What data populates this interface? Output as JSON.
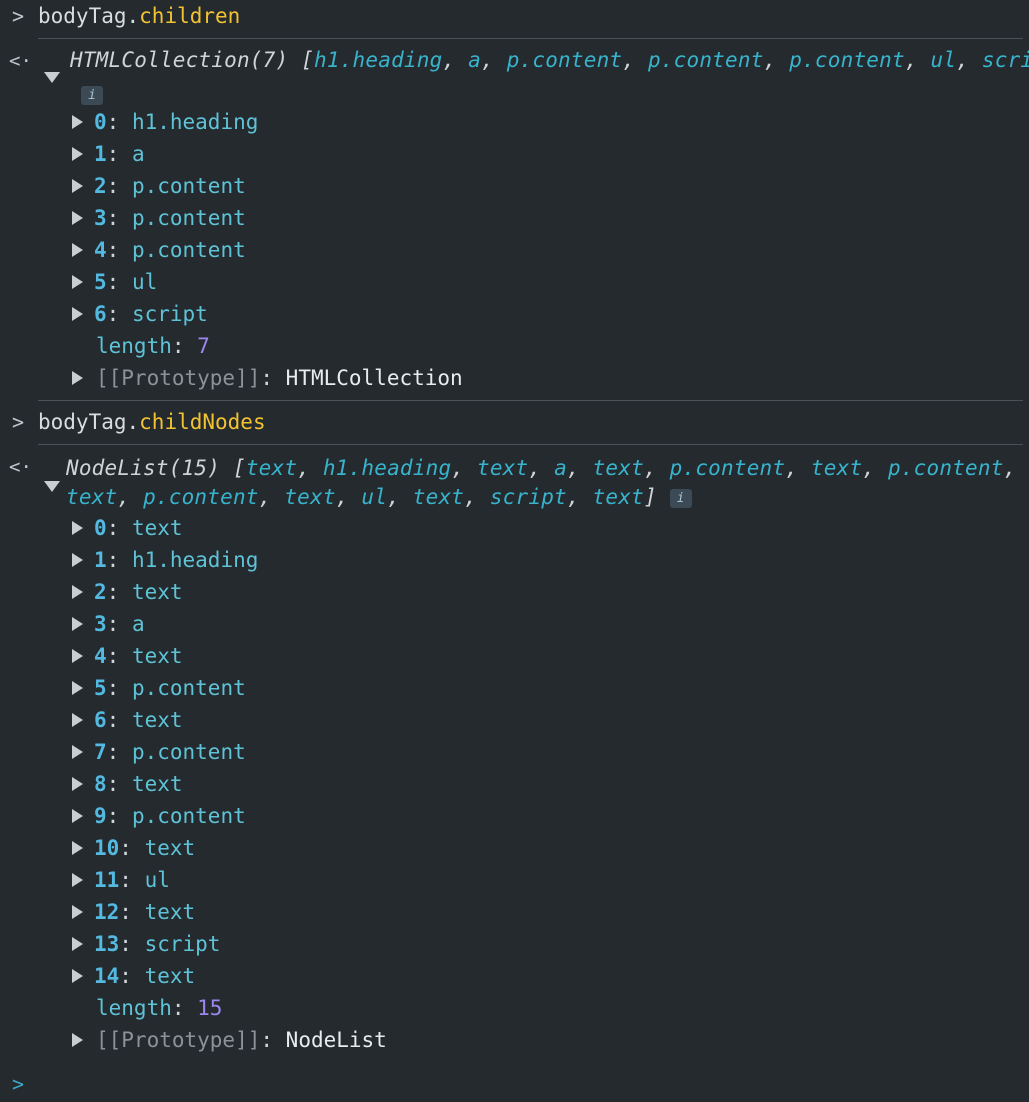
{
  "console": {
    "blocks": [
      {
        "command": {
          "object": "bodyTag.",
          "property": "children"
        },
        "summary": {
          "type": "HTMLCollection(7)",
          "items": [
            "h1.heading",
            "a",
            "p.content",
            "p.content",
            "p.content",
            "ul",
            "script"
          ],
          "info_badge": "i"
        },
        "entries": [
          {
            "index": "0",
            "value": "h1.heading"
          },
          {
            "index": "1",
            "value": "a"
          },
          {
            "index": "2",
            "value": "p.content"
          },
          {
            "index": "3",
            "value": "p.content"
          },
          {
            "index": "4",
            "value": "p.content"
          },
          {
            "index": "5",
            "value": "ul"
          },
          {
            "index": "6",
            "value": "script"
          }
        ],
        "length_key": "length",
        "length_value": "7",
        "prototype_key": "[[Prototype]]",
        "prototype_value": "HTMLCollection"
      },
      {
        "command": {
          "object": "bodyTag.",
          "property": "childNodes"
        },
        "summary": {
          "type": "NodeList(15)",
          "items": [
            "text",
            "h1.heading",
            "text",
            "a",
            "text",
            "p.content",
            "text",
            "p.content",
            "text",
            "p.content",
            "text",
            "ul",
            "text",
            "script",
            "text"
          ],
          "info_badge": "i"
        },
        "entries": [
          {
            "index": "0",
            "value": "text"
          },
          {
            "index": "1",
            "value": "h1.heading"
          },
          {
            "index": "2",
            "value": "text"
          },
          {
            "index": "3",
            "value": "a"
          },
          {
            "index": "4",
            "value": "text"
          },
          {
            "index": "5",
            "value": "p.content"
          },
          {
            "index": "6",
            "value": "text"
          },
          {
            "index": "7",
            "value": "p.content"
          },
          {
            "index": "8",
            "value": "text"
          },
          {
            "index": "9",
            "value": "p.content"
          },
          {
            "index": "10",
            "value": "text"
          },
          {
            "index": "11",
            "value": "ul"
          },
          {
            "index": "12",
            "value": "text"
          },
          {
            "index": "13",
            "value": "script"
          },
          {
            "index": "14",
            "value": "text"
          }
        ],
        "length_key": "length",
        "length_value": "15",
        "prototype_key": "[[Prototype]]",
        "prototype_value": "NodeList"
      }
    ],
    "icons": {
      "prompt": "chevron-right-icon",
      "result": "return-arrow-icon",
      "expand": "triangle-right-icon",
      "collapse": "triangle-down-icon"
    }
  }
}
